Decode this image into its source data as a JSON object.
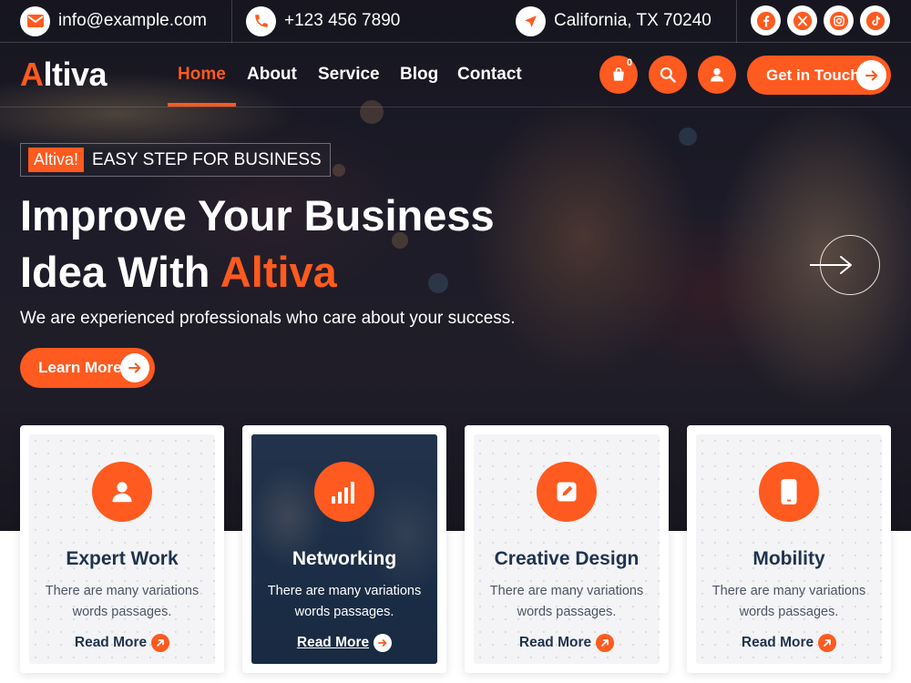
{
  "topbar": {
    "email": "info@example.com",
    "phone": "+123 456 7890",
    "location": "California, TX 70240",
    "icons": {
      "email": "envelope-icon",
      "phone": "phone-icon",
      "location": "location-arrow-icon"
    },
    "social": [
      "facebook-icon",
      "x-twitter-icon",
      "instagram-icon",
      "tiktok-icon"
    ]
  },
  "nav": {
    "logo_first": "A",
    "logo_rest": "ltiva",
    "links": [
      "Home",
      "About",
      "Service",
      "Blog",
      "Contact"
    ],
    "active": "Home",
    "cart_count": "0",
    "cta_label": "Get in Touch"
  },
  "hero": {
    "badge": "Altiva!",
    "tagline": "EASY STEP FOR BUSINESS",
    "headline_line1": "Improve Your Business",
    "headline_line2_prefix": "Idea With ",
    "headline_accent": "Altiva",
    "subtext": "We are experienced professionals who care about your success.",
    "button_label": "Learn More"
  },
  "cards": [
    {
      "title": "Expert Work",
      "desc_line1": "There are many variations",
      "desc_line2": "words passages.",
      "link": "Read More",
      "icon": "user-icon"
    },
    {
      "title": "Networking",
      "desc_line1": "There are many variations",
      "desc_line2": "words passages.",
      "link": "Read More",
      "icon": "signal-bars-icon"
    },
    {
      "title": "Creative Design",
      "desc_line1": "There are many variations",
      "desc_line2": "words passages.",
      "link": "Read More",
      "icon": "edit-icon"
    },
    {
      "title": "Mobility",
      "desc_line1": "There are many variations",
      "desc_line2": "words passages.",
      "link": "Read More",
      "icon": "mobile-icon"
    }
  ],
  "colors": {
    "accent": "#ff5a1f",
    "heading": "#1f3350",
    "body": "#4c5566"
  }
}
